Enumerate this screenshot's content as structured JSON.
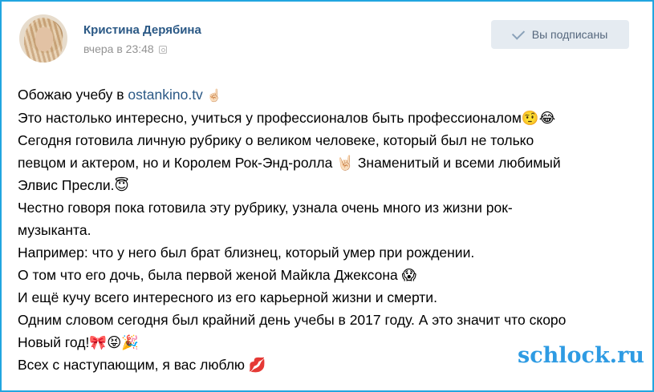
{
  "post": {
    "author": "Кристина Дерябина",
    "time": "вчера в 23:48",
    "subscribe_button": "Вы подписаны",
    "lines": [
      {
        "before": "Обожаю учебу в ",
        "link": "ostankino.tv",
        "after": " ☝🏻"
      },
      {
        "text": "Это настолько интересно, учиться у профессионалов быть профессионалом🤨😂"
      },
      {
        "text": "Сегодня готовила личную рубрику о великом человеке, который был не только"
      },
      {
        "text": "певцом и актером, но и Королем Рок-Энд-ролла 🤘🏻 Знаменитый и всеми любимый"
      },
      {
        "text": "Элвис Пресли.😇"
      },
      {
        "text": "Честно говоря пока готовила эту рубрику, узнала очень много из жизни рок-"
      },
      {
        "text": "музыканта."
      },
      {
        "text": "Например: что у него был брат близнец, который умер при рождении."
      },
      {
        "text": "О том что его дочь, была первой женой Майкла Джексона 😱"
      },
      {
        "text": "И ещё кучу всего интересного из его карьерной жизни и смерти."
      },
      {
        "text": "Одним словом сегодня был крайний день учебы в 2017 году. А это значит что скоро"
      },
      {
        "text": "Новый год!🎀😝🎉"
      },
      {
        "text": "Всех с наступающим, я вас люблю 💋"
      }
    ]
  },
  "watermark": "schlock.ru",
  "colors": {
    "frame": "#21a6e0",
    "author": "#2a5885",
    "link": "#2a5885",
    "button_bg": "#e5ebf1",
    "watermark": "#2e9be3"
  }
}
